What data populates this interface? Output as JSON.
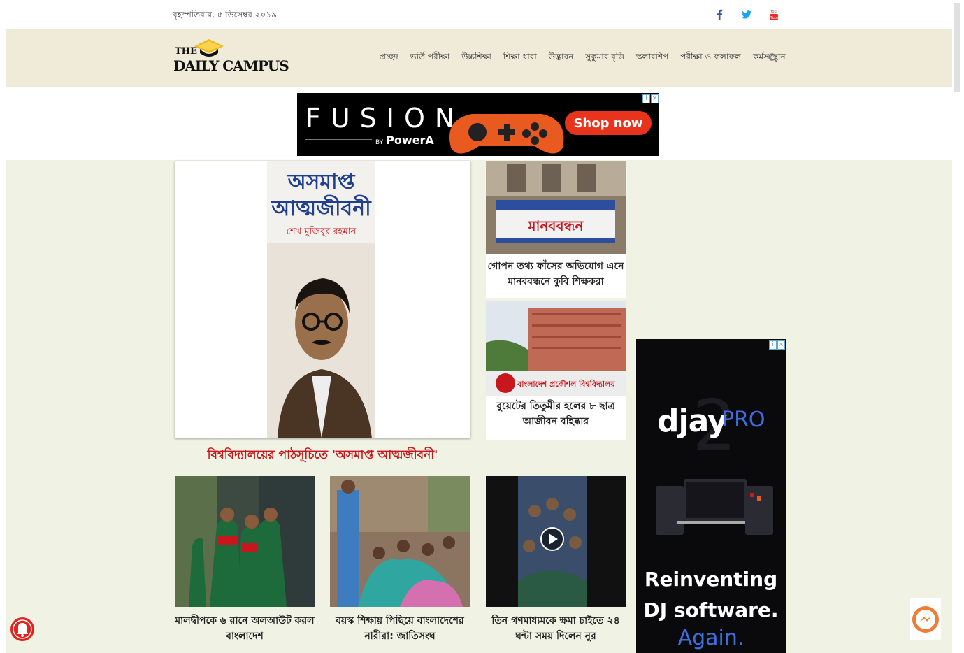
{
  "topbar": {
    "date": "বৃহস্পতিবার, ৫ ডিসেম্বর ২০১৯",
    "social": [
      "facebook-icon",
      "twitter-icon",
      "youtube-icon"
    ]
  },
  "logo": {
    "the": "THE",
    "name": "DAILY CAMPUS"
  },
  "nav": {
    "items": [
      "প্রচ্ছদ",
      "ভর্তি পরীক্ষা",
      "উচ্চশিক্ষা",
      "শিক্ষা ধারা",
      "উদ্ভাবন",
      "সুকুমার বৃত্তি",
      "স্কলারশিপ",
      "পরীক্ষা ও ফলাফল",
      "কর্মসংস্থান"
    ]
  },
  "top_ad": {
    "brand": "FUSION",
    "by": "BY",
    "maker": "PowerA",
    "cta": "Shop now"
  },
  "feature": {
    "book_title_1": "অসমাপ্ত",
    "book_title_2": "আত্মজীবনী",
    "book_author": "শেখ মুজিবুর রহমান",
    "headline": "বিশ্ববিদ্যালয়ের পাঠসূচিতে 'অসমাপ্ত আত্মজীবনী'"
  },
  "side_stories": [
    {
      "banner": "মানববন্ধন",
      "headline": "গোপন তথ্য ফাঁসের অভিযোগ এনে মানববন্ধনে কুবি শিক্ষকরা"
    },
    {
      "banner": "বাংলাদেশ প্রকৌশল বিশ্ববিদ্যালয়",
      "headline": "বুয়েটের তিতুমীর হলের ৮ ছাত্র আজীবন বহিষ্কার"
    }
  ],
  "bottom_stories": [
    {
      "headline": "মালদ্বীপকে ৬ রানে অলআউট করল বাংলাদেশ"
    },
    {
      "headline": "বয়স্ক শিক্ষায় পিছিয়ে বাংলাদেশের নারীরা: জাতিসংঘ"
    },
    {
      "headline": "তিন গণমাধ্যমকে ক্ষমা চাইতে ২৪ ঘন্টা সময় দিলেন নুর"
    }
  ],
  "side_ad": {
    "brand": "djay",
    "pro": "PRO",
    "line1": "Reinventing",
    "line2": "DJ software.",
    "line3": "Again."
  },
  "colors": {
    "header_bg": "#f0ebd8",
    "main_bg": "#f0f2e4",
    "headline_red": "#c8161d",
    "fb_blue": "#3b5998",
    "tw_blue": "#1da1f2",
    "yt_red": "#e52d27"
  }
}
